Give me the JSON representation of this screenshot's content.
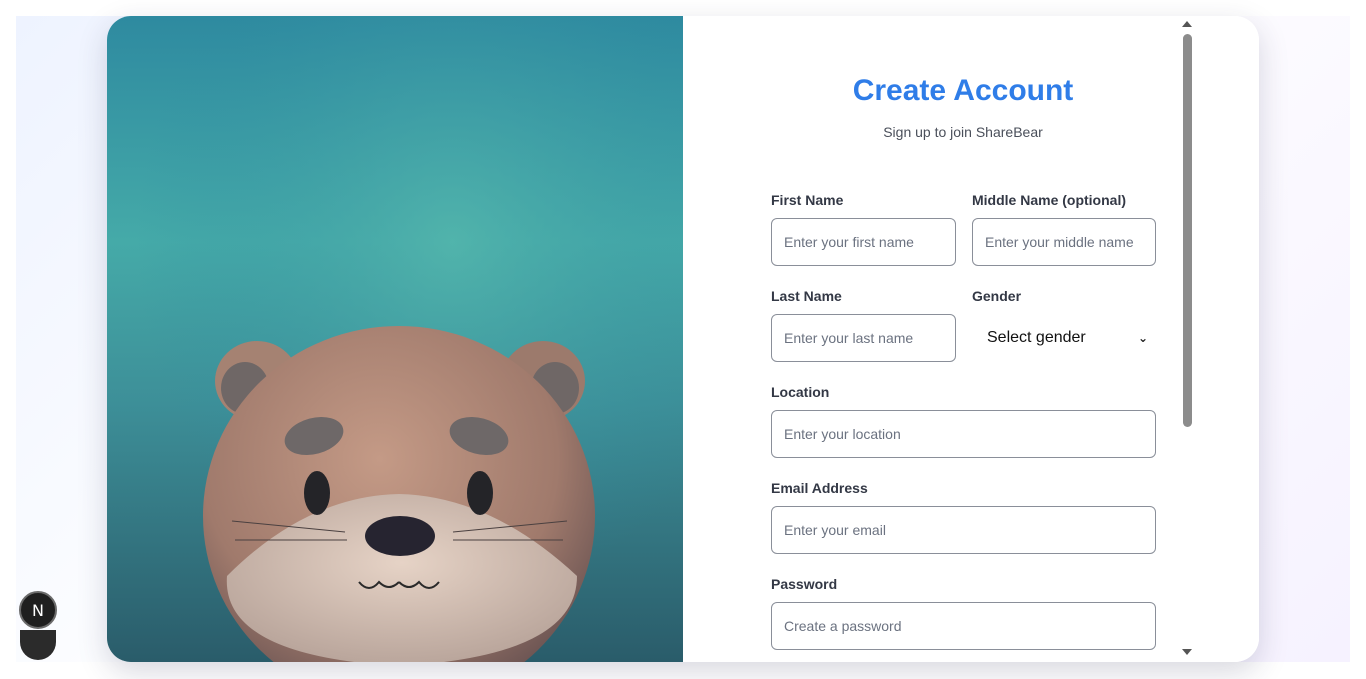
{
  "form": {
    "title": "Create Account",
    "subtitle": "Sign up to join ShareBear",
    "first_name": {
      "label": "First Name",
      "placeholder": "Enter your first name"
    },
    "middle_name": {
      "label": "Middle Name (optional)",
      "placeholder": "Enter your middle name"
    },
    "last_name": {
      "label": "Last Name",
      "placeholder": "Enter your last name"
    },
    "gender": {
      "label": "Gender",
      "selected": "Select gender"
    },
    "location": {
      "label": "Location",
      "placeholder": "Enter your location"
    },
    "email": {
      "label": "Email Address",
      "placeholder": "Enter your email"
    },
    "password": {
      "label": "Password",
      "placeholder": "Create a password"
    }
  },
  "dev_badge": {
    "letter": "N"
  },
  "colors": {
    "accent": "#2f7de8",
    "hero_top": "#2e8aa0",
    "hero_bottom": "#2a5c6a"
  },
  "icons": {
    "gender_dropdown": "chevron-down-icon",
    "scroll_up": "arrow-up-icon",
    "scroll_down": "arrow-down-icon"
  }
}
